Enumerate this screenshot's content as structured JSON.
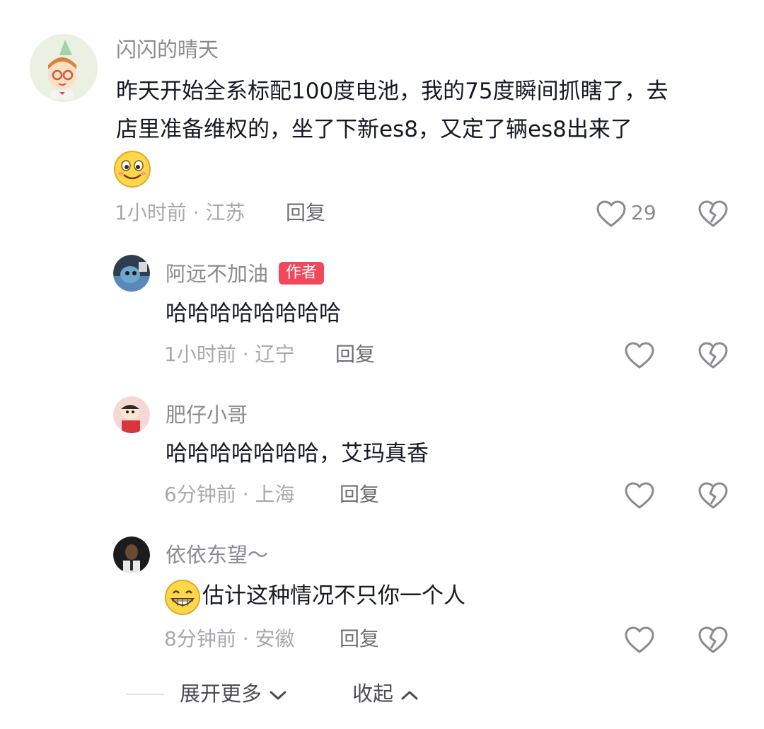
{
  "comments": [
    {
      "username": "闪闪的晴天",
      "text_line1": "昨天开始全系标配100度电池，我的75度瞬间抓瞎了，去",
      "text_line2": "店里准备维权的，坐了下新es8，又定了辆es8出来了",
      "time": "1小时前",
      "location": "江苏",
      "reply": "回复",
      "likes": "29",
      "emoji": "smiling-face"
    },
    {
      "username": "阿远不加油",
      "badge": "作者",
      "text": "哈哈哈哈哈哈哈哈",
      "time": "1小时前",
      "location": "辽宁",
      "reply": "回复"
    },
    {
      "username": "肥仔小哥",
      "text": "哈哈哈哈哈哈哈，艾玛真香",
      "time": "6分钟前",
      "location": "上海",
      "reply": "回复"
    },
    {
      "username": "依依东望～",
      "text": "估计这种情况不只你一个人",
      "time": "8分钟前",
      "location": "安徽",
      "reply": "回复",
      "emoji": "grinning-face"
    }
  ],
  "footer": {
    "expand": "展开更多",
    "collapse": "收起"
  },
  "colors": {
    "badge": "#f2485d",
    "text": "#161823",
    "muted": "#a8a9ad"
  }
}
